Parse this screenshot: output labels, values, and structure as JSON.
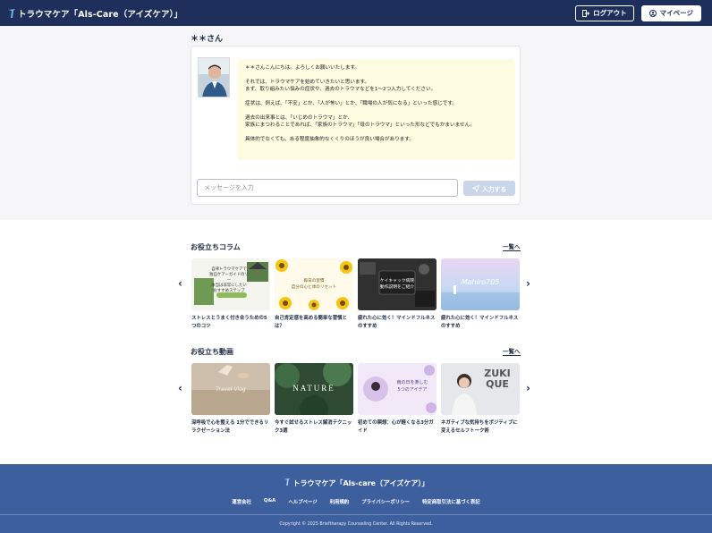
{
  "header": {
    "brand": "トラウマケア「Als-Care（アイズケア）」",
    "logout_label": "ログアウト",
    "mypage_label": "マイページ"
  },
  "chat": {
    "user_name": "＊＊さん",
    "messages": [
      "＊＊さんこんにちは。よろしくお願いいたします。",
      "それでは、トラウマケアを始めていきたいと思います。\nまず、取り組みたい悩みの症状や、過去のトラウマなどを1〜2つ入力してください。",
      "症状は、例えば、「不安」とか、「人が怖い」とか、「職場の人が気になる」といった感じです。",
      "過去の出来事とは、「いじめのトラウマ」とか、\n家族にまつわることであれば、「家族のトラウマ」「母のトラウマ」といった形などでもかまいません。",
      "具体的でなくても、ある程度抽象的なくくりのほうが良い場合があります。"
    ],
    "input_placeholder": "メッセージを入力",
    "send_label": "入力する"
  },
  "columns": {
    "title": "お役立ちコラム",
    "see_all": "一覧へ",
    "items": [
      {
        "title": "ストレスとうまく付き合うための5つのコツ",
        "thumb_text": "自律トラウマケアで\n独自ケアーガイドのリー\n本当は非常にしたい\nおすすめステップ"
      },
      {
        "title": "自己肯定感を高める簡単な習慣とは？",
        "thumb_text": "毎日の習慣\n自分の心と体のリセット"
      },
      {
        "title": "疲れた心に効く！マインドフルネスのすすめ",
        "thumb_text": "ケイキャック病院\n動作説明をご紹介"
      },
      {
        "title": "疲れた心に効く！マインドフルネスのすすめ",
        "thumb_text": "Mahiro705"
      }
    ]
  },
  "videos": {
    "title": "お役立ち動画",
    "see_all": "一覧へ",
    "items": [
      {
        "title": "深呼吸で心を整える 1分でできるリラクゼーション法",
        "thumb_text": "Travel Vlog"
      },
      {
        "title": "今すぐ試せるストレス解消テクニック3選",
        "thumb_text": "NATURE"
      },
      {
        "title": "初めての瞑想：心が軽くなる3分ガイド",
        "thumb_text": "雨の日を楽しむ\n5つのアイデア"
      },
      {
        "title": "ネガティブな気持ちをポジティブに変えるセルフトーク術",
        "thumb_text": "ZUKI\nQUE"
      }
    ]
  },
  "footer": {
    "brand": "トラウマケア「Als-care（アイズケア）」",
    "links": [
      "運営会社",
      "Q&A",
      "ヘルプページ",
      "利用規約",
      "プライバシーポリシー",
      "特定商取引法に基づく表記"
    ],
    "copyright": "Copyright © 2025 Brieftherapy Counseling Center. All Rights Reserved."
  },
  "colors": {
    "header_bg": "#1f2f5c",
    "footer_bg": "#3e5f9e",
    "bubble_bg": "#fdfbe0",
    "send_btn_bg": "#c9d6ea"
  }
}
